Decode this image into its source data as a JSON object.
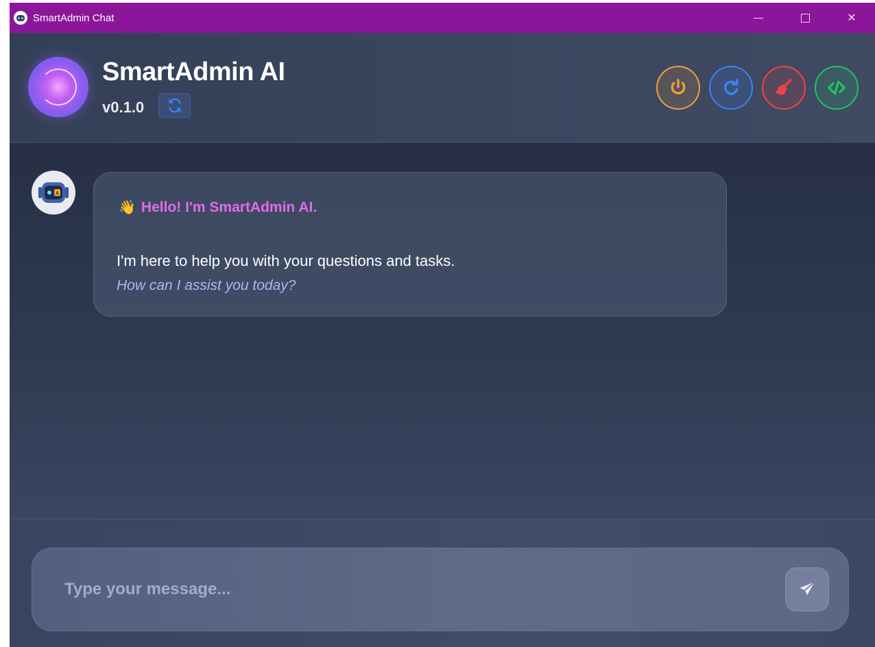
{
  "window": {
    "title": "SmartAdmin Chat",
    "controls": {
      "minimize": "minimize",
      "maximize": "maximize",
      "close": "✕"
    }
  },
  "header": {
    "title": "SmartAdmin AI",
    "version": "v0.1.0",
    "actions": [
      {
        "name": "power",
        "icon": "power-icon",
        "color": "#f2a13a"
      },
      {
        "name": "refresh",
        "icon": "refresh-icon",
        "color": "#3b82f6"
      },
      {
        "name": "clear",
        "icon": "broom-icon",
        "color": "#ef4444"
      },
      {
        "name": "code",
        "icon": "code-icon",
        "color": "#22c55e"
      }
    ]
  },
  "chat": {
    "messages": [
      {
        "sender": "bot",
        "greeting_emoji": "👋",
        "greeting": "Hello! I'm SmartAdmin AI.",
        "line1": "I'm here to help you with your questions and tasks.",
        "line2": "How can I assist you today?"
      }
    ]
  },
  "composer": {
    "placeholder": "Type your message...",
    "value": ""
  },
  "colors": {
    "titlebar": "#8c169a",
    "accent_greeting": "#e36be8",
    "accent_italic": "#b6b0f0"
  }
}
